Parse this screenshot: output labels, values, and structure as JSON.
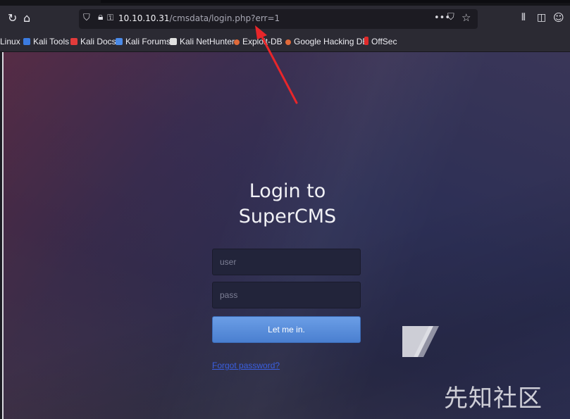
{
  "toolbar": {
    "reload_icon": "reload-icon",
    "home_icon": "home-icon",
    "url_host": "10.10.10.31",
    "url_path": "/cmsdata/login.php?err=1",
    "page_actions_label": "•••"
  },
  "bookmarks": [
    {
      "label": "Linux",
      "color": ""
    },
    {
      "label": "Kali Tools",
      "color": "#3b7be0"
    },
    {
      "label": "Kali Docs",
      "color": "#e23b3b"
    },
    {
      "label": "Kali Forums",
      "color": "#4a8ae8"
    },
    {
      "label": "Kali NetHunter",
      "color": "#e0e0e0"
    },
    {
      "label": "Exploit-DB",
      "color": "#e06a3a"
    },
    {
      "label": "Google Hacking DB",
      "color": "#e06a3a"
    },
    {
      "label": "OffSec",
      "color": "#e02a2a"
    }
  ],
  "login": {
    "title_line1": "Login to",
    "title_line2": "SuperCMS",
    "user_placeholder": "user",
    "pass_placeholder": "pass",
    "submit_label": "Let me in.",
    "forgot_label": "Forgot password?"
  },
  "watermark": {
    "text": "先知社区"
  },
  "colors": {
    "accent_button": "#5a8ddb",
    "link": "#3a5fe0",
    "arrow": "#e8262a"
  }
}
